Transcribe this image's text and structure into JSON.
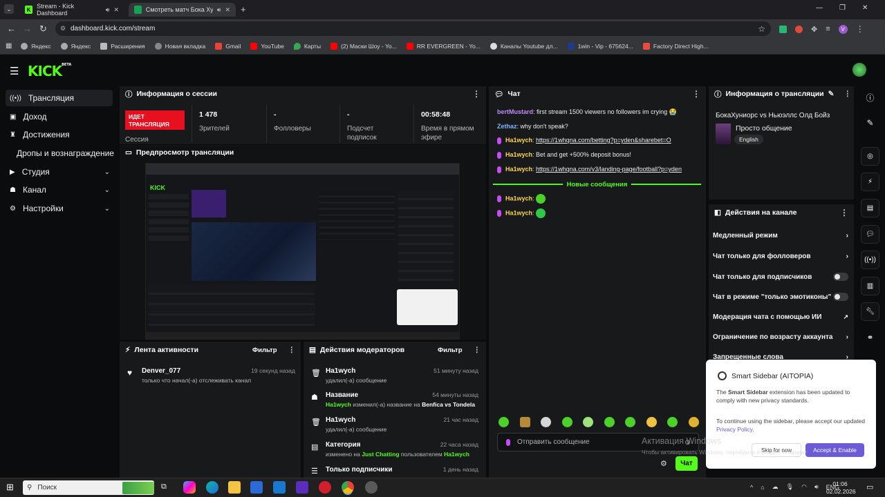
{
  "browser": {
    "tabs": [
      {
        "title": "Stream - Kick Dashboard",
        "active": false
      },
      {
        "title": "Смотреть матч Бока Хуни",
        "active": true
      }
    ],
    "url": "dashboard.kick.com/stream",
    "bookmarks": [
      "Яндекс",
      "Яндекс",
      "Расширения",
      "Новая вкладка",
      "Gmail",
      "YouTube",
      "Карты",
      "(2) Маски Шоу - Yo...",
      "RR EVERGREEN - Yo...",
      "Каналы Youtube дл...",
      "1win - Vip - 675624...",
      "Factory Direct High..."
    ]
  },
  "app": {
    "logo": "KICK",
    "logo_beta": "BETA"
  },
  "sidebar": [
    {
      "label": "Трансляция",
      "icon": "broadcast-icon",
      "active": true,
      "chevron": false
    },
    {
      "label": "Доход",
      "icon": "dollar-icon",
      "active": false,
      "chevron": false
    },
    {
      "label": "Достижения",
      "icon": "trophy-icon",
      "active": false,
      "chevron": false
    },
    {
      "label": "Дропы и вознаграждение",
      "icon": "",
      "active": false,
      "chevron": false
    },
    {
      "label": "Студия",
      "icon": "camera-icon",
      "active": false,
      "chevron": true
    },
    {
      "label": "Канал",
      "icon": "user-icon",
      "active": false,
      "chevron": true
    },
    {
      "label": "Настройки",
      "icon": "gear-icon",
      "active": false,
      "chevron": true
    }
  ],
  "session": {
    "title": "Информация о сессии",
    "live_badge": "ИДЕТ ТРАНСЛЯЦИЯ",
    "live_sub": "Сессия",
    "stats": [
      {
        "value": "1 478",
        "label": "Зрителей"
      },
      {
        "value": "-",
        "label": "Фолловеры"
      },
      {
        "value": "-",
        "label": "Подсчет подписок"
      },
      {
        "value": "00:58:48",
        "label": "Время в прямом эфире"
      }
    ]
  },
  "preview": {
    "title": "Предпросмотр трансляции"
  },
  "chat": {
    "title": "Чат",
    "messages": [
      {
        "user": "bertMustard",
        "color": "#c08bff",
        "text": ": first stream 1500 viewers no followers im crying 😭",
        "link": false,
        "mic": false
      },
      {
        "user": "Zethaz",
        "color": "#7fb6ff",
        "text": ": why don't speak?",
        "link": false,
        "mic": false
      },
      {
        "user": "Ha1wych",
        "color": "#ffd54a",
        "text": "https://1whqna.com/betting?p=yden&sharebet=O",
        "link": true,
        "mic": true
      },
      {
        "user": "Ha1wych",
        "color": "#ffd54a",
        "text": ": Bet and get +500% deposit bonus!",
        "link": false,
        "mic": true
      },
      {
        "user": "Ha1wych",
        "color": "#ffd54a",
        "text": "https://1whqna.com/v3/landing-page/football?p=yden",
        "link": true,
        "mic": true
      }
    ],
    "new_messages_label": "Новые сообщения",
    "new_messages": [
      {
        "user": "Ha1wych",
        "color": "#ffd54a"
      },
      {
        "user": "Ha1wych",
        "color": "#ffd54a"
      }
    ],
    "input_placeholder": "Отправить сообщение",
    "send_label": "Чат"
  },
  "stream_info": {
    "title": "Информация о трансляции",
    "stream_title": "БокаХуниорс vs Ньюэллс Олд Бойз",
    "category": "Просто общение",
    "language": "English"
  },
  "channel_actions": {
    "title": "Действия на канале",
    "items": [
      {
        "label": "Медленный режим",
        "control": "chevron"
      },
      {
        "label": "Чат только для фолловеров",
        "control": "chevron"
      },
      {
        "label": "Чат только для подписчиков",
        "control": "toggle"
      },
      {
        "label": "Чат в режиме \"только эмотиконы\"",
        "control": "toggle"
      },
      {
        "label": "Модерация чата с помощью ИИ",
        "control": "external"
      },
      {
        "label": "Ограничение по возрасту аккаунта",
        "control": "chevron"
      },
      {
        "label": "Запрещенные слова",
        "control": "chevron"
      }
    ]
  },
  "activity": {
    "title": "Лента активности",
    "filter": "Фильтр",
    "items": [
      {
        "user": "Denver_077",
        "desc": "только что начал(-а) отслеживать канал",
        "time": "19 секунд назад"
      }
    ]
  },
  "mod_actions": {
    "title": "Действия модераторов",
    "filter": "Фильтр",
    "items": [
      {
        "title": "Ha1wych",
        "desc": "удалил(-а) сообщение",
        "time": "51 минуту назад",
        "icon": "trash-icon"
      },
      {
        "title": "Название",
        "desc_user": "Ha1wych",
        "desc": " изменил(-а) название на ",
        "desc_tail": "Benfica vs Tondela",
        "time": "54 минуты назад",
        "icon": "user-edit-icon"
      },
      {
        "title": "Ha1wych",
        "desc": "удалил(-а) сообщение",
        "time": "21 час назад",
        "icon": "trash-icon"
      },
      {
        "title": "Категория",
        "desc_pre": "изменено на ",
        "desc_green": "Just Chatting",
        "desc_mid": " пользователем ",
        "desc_user": "Ha1wych",
        "time": "22 часа назад",
        "icon": "category-icon"
      },
      {
        "title": "Только подписчики",
        "time": "1 день назад",
        "icon": "subscribers-icon"
      }
    ]
  },
  "popup": {
    "title": "Smart Sidebar (AITOPIA)",
    "body1_pre": "The ",
    "body1_bold": "Smart Sidebar",
    "body1_post": " extension has been updated to comply with new privacy standards.",
    "body2_pre": "To continue using the sidebar, please accept our updated ",
    "body2_link": "Privacy Policy",
    "body2_post": ".",
    "skip": "Skip for now",
    "accept": "Accept & Enable"
  },
  "windows": {
    "activation_title": "Активация Windows",
    "activation_sub": "Чтобы активировать Windows, перейдите в раздел «Параметры».",
    "search": "Поиск",
    "lang": "ENG",
    "time": "01:06",
    "date": "02.02.2026"
  }
}
